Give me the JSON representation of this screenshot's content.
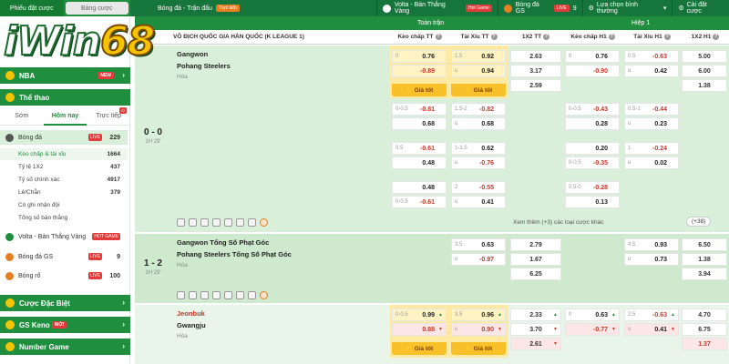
{
  "sidebar": {
    "bet_tabs": [
      "Phiếu đặt cược",
      "Bảng cược"
    ],
    "logo_text_a": "iWin",
    "logo_text_b": "68",
    "nba": "NBA",
    "nba_badge": "NEW",
    "the_thao": "Thể thao",
    "time_tabs": [
      "Sớm",
      "Hôm nay",
      "Trực tiếp"
    ],
    "live_count": "22",
    "sports": [
      {
        "label": "Bóng đá",
        "badge": "LIVE",
        "count": "229"
      },
      {
        "label": "Volta - Bàn Thắng Vàng",
        "badge": "HOT GAME",
        "count": ""
      },
      {
        "label": "Bóng đá GS",
        "badge": "LIVE",
        "count": "9"
      },
      {
        "label": "Bóng rổ",
        "badge": "LIVE",
        "count": "100"
      }
    ],
    "subs": [
      {
        "label": "Kèo chấp & tài xỉu",
        "count": "1664"
      },
      {
        "label": "Tỷ lệ 1X2",
        "count": "437"
      },
      {
        "label": "Tỷ số chính xác",
        "count": "4917"
      },
      {
        "label": "Lẻ/Chẵn",
        "count": "379"
      },
      {
        "label": "Có ghi nhận đội",
        "count": ""
      },
      {
        "label": "Tổng số bàn thắng",
        "count": ""
      }
    ],
    "cuoc_dac_biet": "Cược Đặc Biệt",
    "gs_keno": "GS Keno",
    "gs_keno_badge": "MỚI",
    "number_game": "Number Game"
  },
  "topbar": {
    "crumb": "Bóng đá - Trận đấu",
    "crumb_tag": "Trực tiếp",
    "volta": "Volta - Bàn Thắng Vàng",
    "volta_tag": "Hot Game",
    "bongda_gs": "Bóng đá GS",
    "bongda_gs_tag": "LIVE",
    "bongda_gs_count": "9",
    "odds_select": "Lựa chọn bình thường",
    "settings": "Cài đặt cược"
  },
  "table": {
    "league": "HÀN QUỐC (K LEAGUE 1)",
    "league_prefix": "VÔ ĐỊCH QUỐC GIA",
    "group_full": "Toàn trận",
    "group_h1": "Hiệp 1",
    "cols": [
      "Kèo chấp TT",
      "Tài Xỉu TT",
      "1X2 TT",
      "Kèo chấp H1",
      "Tài Xỉu H1",
      "1X2 H1"
    ],
    "best_label": "Giá tốt",
    "more_text": "Xem thêm (+3) các loại cược khác",
    "more_btn": "(+38)"
  },
  "matches": [
    {
      "score": "0 - 0",
      "half": "1H 29'",
      "home": "Gangwon",
      "away": "Pohang Steelers",
      "draw": "Hòa",
      "rows": [
        {
          "kc": [
            "0",
            "0.76",
            "",
            "-0.89"
          ],
          "tx": [
            "1.5",
            "0.92",
            "u",
            "0.94"
          ],
          "x12": [
            "2.63",
            "3.17",
            "2.59"
          ],
          "kch1": [
            "0",
            "0.76",
            "",
            "-0.90"
          ],
          "txh1": [
            "0.5",
            "-0.63",
            "u",
            "0.42"
          ],
          "x12h1": [
            "5.00",
            "6.00",
            "1.38"
          ]
        },
        {
          "kc": [
            "0-0.5",
            "-0.81",
            "",
            "0.68"
          ],
          "tx": [
            "1.5-2",
            "-0.82",
            "u",
            "0.68"
          ],
          "kch1": [
            "0-0.5",
            "-0.43",
            "",
            "0.28"
          ],
          "txh1": [
            "0.5-1",
            "-0.44",
            "u",
            "0.23"
          ]
        },
        {
          "kc": [
            "0.5",
            "-0.61",
            "",
            "0.48"
          ],
          "tx": [
            "1-1.5",
            "0.62",
            "u",
            "-0.76"
          ],
          "kch1": [
            "",
            "0.20",
            "0-0.5",
            "-0.35"
          ],
          "txh1": [
            "1",
            "-0.24",
            "u",
            "0.02"
          ]
        },
        {
          "kc": [
            "",
            "0.48",
            "0-0.5",
            "-0.61"
          ],
          "tx": [
            "2",
            "-0.55",
            "u",
            "0.41"
          ],
          "kch1": [
            "0.5-0",
            "-0.28",
            "",
            "0.13"
          ]
        }
      ]
    },
    {
      "score": "1 - 2",
      "half": "1H 29'",
      "home": "Gangwon Tổng Số Phạt Góc",
      "away": "Pohang Steelers Tổng Số Phạt Góc",
      "draw": "Hòa",
      "tx": [
        "3.5",
        "0.63",
        "u",
        "-0.97"
      ],
      "x12": [
        "2.79",
        "1.67",
        "6.25"
      ],
      "txh1": [
        "4.5",
        "0.93",
        "u",
        "0.73"
      ],
      "x12h1": [
        "6.50",
        "1.38",
        "3.94"
      ]
    },
    {
      "score": "",
      "home": "Jeonbuk",
      "away": "Gwangju",
      "draw": "Hòa",
      "kc": [
        "0-0.5",
        "0.99",
        "",
        "0.88"
      ],
      "tx": [
        "3.5",
        "0.96",
        "u",
        "0.90"
      ],
      "x12": [
        "2.33",
        "3.70",
        "2.61"
      ],
      "kch1": [
        "0",
        "0.63",
        "",
        "-0.77"
      ],
      "txh1": [
        "2.5",
        "-0.63",
        "u",
        "0.41"
      ],
      "x12h1": [
        "4.70",
        "6.75",
        "1.37"
      ]
    }
  ]
}
